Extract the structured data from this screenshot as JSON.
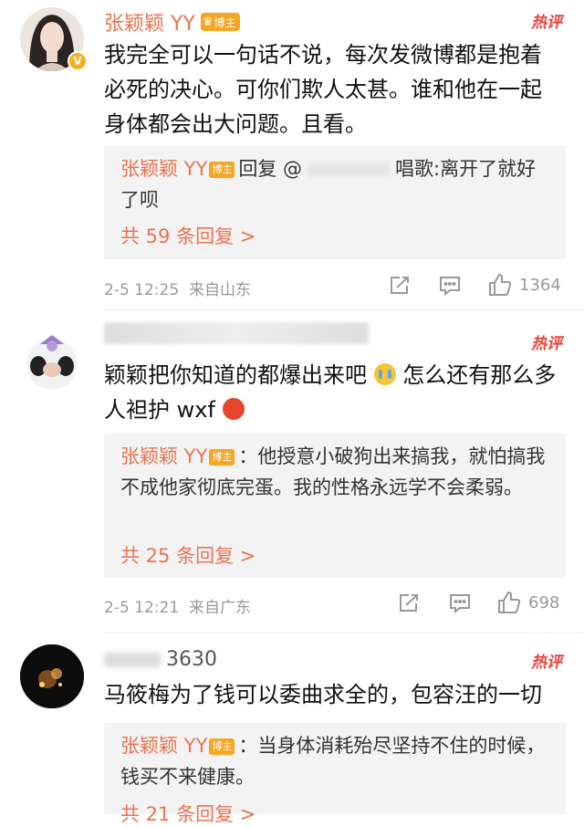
{
  "comments": [
    {
      "name": "张颖颖 YY",
      "badge": "博主",
      "hot_label": "热评",
      "text": "我完全可以一句话不说，每次发微博都是抱着必死的决心。可你们欺人太甚。谁和他在一起身体都会出大问题。且看。",
      "reply": {
        "author": "张颖颖 YY",
        "badge": "博主",
        "text_a": "回复 @",
        "text_b": "唱歌:离开了就好了呗",
        "count_label": "共 59 条回复 >"
      },
      "time": "2-5 12:25",
      "location": "来自山东",
      "likes": "1364"
    },
    {
      "name": "",
      "hot_label": "热评",
      "text_a": "颖颖把你知道的都爆出来吧",
      "text_b": "怎么还有那么多人袒护 wxf",
      "reply": {
        "author": "张颖颖 YY",
        "badge": "博主",
        "text": "：他授意小破狗出来搞我，就怕搞我不成他家彻底完蛋。我的性格永远学不会柔弱。",
        "count_label": "共 25 条回复 >"
      },
      "time": "2-5 12:21",
      "location": "来自广东",
      "likes": "698"
    },
    {
      "name": "3630",
      "hot_label": "热评",
      "text": "马筱梅为了钱可以委曲求全的，包容汪的一切",
      "reply": {
        "author": "张颖颖 YY",
        "badge": "博主",
        "text": "：当身体消耗殆尽坚持不住的时候，钱买不来健康。",
        "count_label": "共 21 条回复 >"
      }
    }
  ],
  "colors": {
    "accent": "#eb7350",
    "hot": "#e8423b",
    "badge": "#f6a623"
  }
}
